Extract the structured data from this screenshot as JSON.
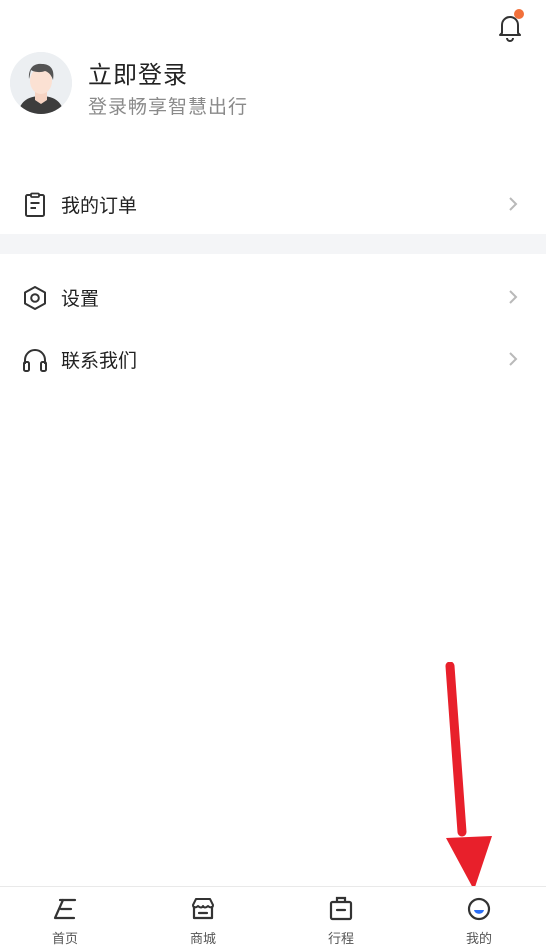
{
  "header": {
    "notification_icon": "bell-icon",
    "notification_dot_color": "#f2703a"
  },
  "profile": {
    "avatar_icon": "user-avatar",
    "title": "立即登录",
    "subtitle": "登录畅享智慧出行"
  },
  "menu": {
    "orders": {
      "label": "我的订单",
      "icon": "clipboard-icon"
    },
    "settings": {
      "label": "设置",
      "icon": "hexagon-settings-icon"
    },
    "contact": {
      "label": "联系我们",
      "icon": "headphones-icon"
    }
  },
  "tabbar": {
    "active_color": "#2a6ef5",
    "tabs": [
      {
        "label": "首页",
        "icon": "home-icon"
      },
      {
        "label": "商城",
        "icon": "store-icon"
      },
      {
        "label": "行程",
        "icon": "bag-icon"
      },
      {
        "label": "我的",
        "icon": "profile-icon",
        "active": true
      }
    ]
  },
  "annotation": {
    "arrow_color": "#e8202b"
  }
}
